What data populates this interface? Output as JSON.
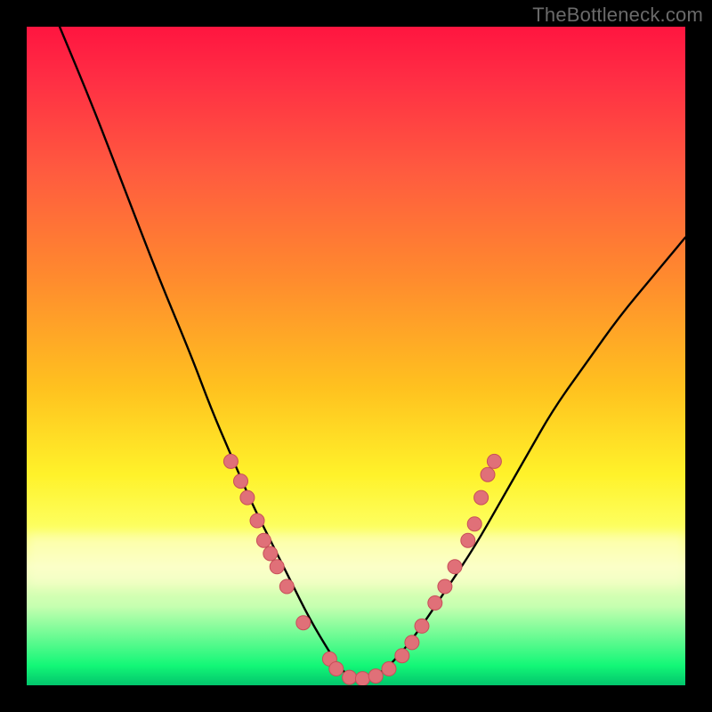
{
  "watermark": "TheBottleneck.com",
  "chart_data": {
    "type": "line",
    "title": "",
    "xlabel": "",
    "ylabel": "",
    "x_range": [
      0,
      100
    ],
    "y_range": [
      0,
      100
    ],
    "note": "Axes are in percent of plot area; y increases downward toward the green (lower bottleneck). Curve is a V-shape with minimum near x≈50.",
    "series": [
      {
        "name": "bottleneck-curve",
        "x": [
          5,
          10,
          15,
          20,
          25,
          28,
          31,
          34,
          37,
          40,
          43,
          46,
          48,
          50,
          52,
          54,
          57,
          60,
          64,
          68,
          72,
          76,
          80,
          85,
          90,
          95,
          100
        ],
        "y_pct": [
          0,
          12,
          25,
          38,
          50,
          58,
          65,
          72,
          78,
          84,
          90,
          95,
          98,
          99,
          99,
          98,
          95,
          91,
          85,
          79,
          72,
          65,
          58,
          51,
          44,
          38,
          32
        ]
      }
    ],
    "scatter_points": {
      "name": "highlighted-dots",
      "note": "Salmon dots clustered on the lower arms of the V.",
      "points": [
        {
          "x": 31,
          "y_pct": 66
        },
        {
          "x": 32.5,
          "y_pct": 69
        },
        {
          "x": 33.5,
          "y_pct": 71.5
        },
        {
          "x": 35,
          "y_pct": 75
        },
        {
          "x": 36,
          "y_pct": 78
        },
        {
          "x": 37,
          "y_pct": 80
        },
        {
          "x": 38,
          "y_pct": 82
        },
        {
          "x": 39.5,
          "y_pct": 85
        },
        {
          "x": 42,
          "y_pct": 90.5
        },
        {
          "x": 46,
          "y_pct": 96
        },
        {
          "x": 47,
          "y_pct": 97.5
        },
        {
          "x": 49,
          "y_pct": 98.8
        },
        {
          "x": 51,
          "y_pct": 99
        },
        {
          "x": 53,
          "y_pct": 98.6
        },
        {
          "x": 55,
          "y_pct": 97.5
        },
        {
          "x": 57,
          "y_pct": 95.5
        },
        {
          "x": 58.5,
          "y_pct": 93.5
        },
        {
          "x": 60,
          "y_pct": 91
        },
        {
          "x": 62,
          "y_pct": 87.5
        },
        {
          "x": 63.5,
          "y_pct": 85
        },
        {
          "x": 65,
          "y_pct": 82
        },
        {
          "x": 67,
          "y_pct": 78
        },
        {
          "x": 68,
          "y_pct": 75.5
        },
        {
          "x": 69,
          "y_pct": 71.5
        },
        {
          "x": 70,
          "y_pct": 68
        },
        {
          "x": 71,
          "y_pct": 66
        }
      ]
    },
    "background_gradient": {
      "top_color": "#ff1540",
      "bottom_color": "#02c56c",
      "description": "Vertical rainbow gradient from red (top) through orange/yellow to green (bottom), representing bottleneck severity."
    }
  }
}
